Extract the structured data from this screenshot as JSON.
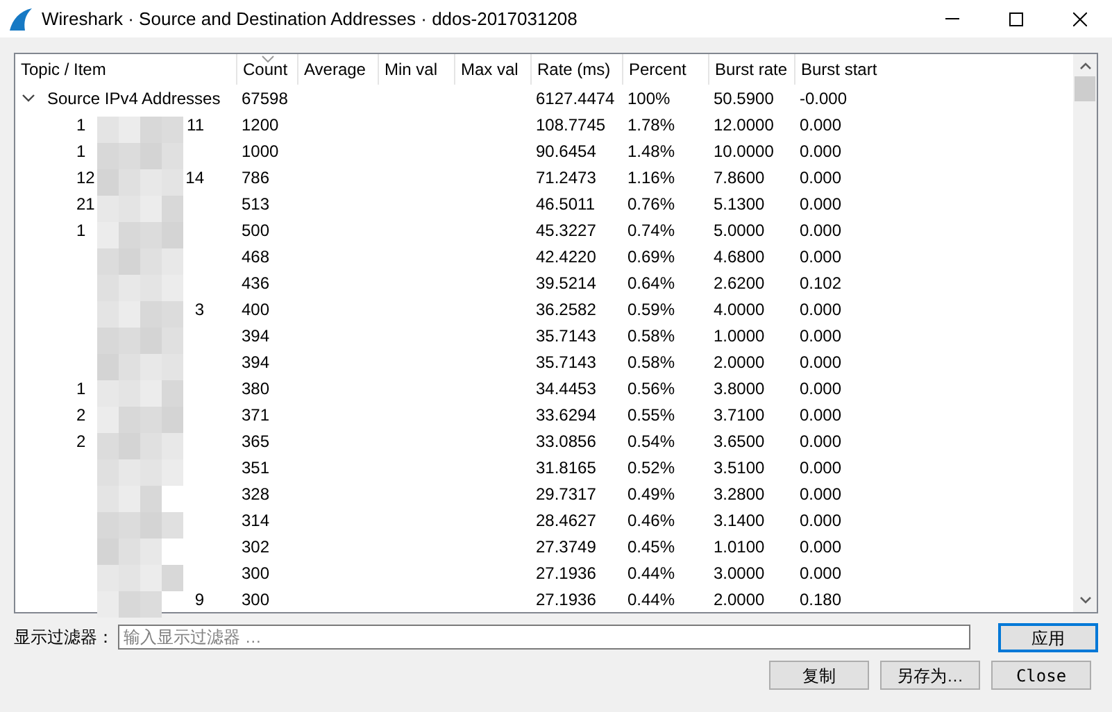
{
  "window": {
    "title": "Wireshark · Source and Destination Addresses · ddos-2017031208"
  },
  "table": {
    "columns": [
      {
        "label": "Topic / Item",
        "sorted": false
      },
      {
        "label": "Count",
        "sorted": true
      },
      {
        "label": "Average",
        "sorted": false
      },
      {
        "label": "Min val",
        "sorted": false
      },
      {
        "label": "Max val",
        "sorted": false
      },
      {
        "label": "Rate (ms)",
        "sorted": false
      },
      {
        "label": "Percent",
        "sorted": false
      },
      {
        "label": "Burst rate",
        "sorted": false
      },
      {
        "label": "Burst start",
        "sorted": false
      }
    ],
    "tree": [
      {
        "item": "Source IPv4 Addresses",
        "expanded": true,
        "count": "67598",
        "rate": "6127.4474",
        "percent": "100%",
        "burst_rate": "50.5900",
        "burst_start": "-0.000",
        "children": [
          {
            "item_head": "1",
            "item_tail": "11",
            "count": "1200",
            "rate": "108.7745",
            "percent": "1.78%",
            "burst_rate": "12.0000",
            "burst_start": "0.000"
          },
          {
            "item_head": "1",
            "count": "1000",
            "rate": "90.6454",
            "percent": "1.48%",
            "burst_rate": "10.0000",
            "burst_start": "0.000"
          },
          {
            "item_head": "12",
            "item_tail": "14",
            "count": "786",
            "rate": "71.2473",
            "percent": "1.16%",
            "burst_rate": "7.8600",
            "burst_start": "0.000"
          },
          {
            "item_head": "21",
            "count": "513",
            "rate": "46.5011",
            "percent": "0.76%",
            "burst_rate": "5.1300",
            "burst_start": "0.000"
          },
          {
            "item_head": "1",
            "count": "500",
            "rate": "45.3227",
            "percent": "0.74%",
            "burst_rate": "5.0000",
            "burst_start": "0.000"
          },
          {
            "count": "468",
            "rate": "42.4220",
            "percent": "0.69%",
            "burst_rate": "4.6800",
            "burst_start": "0.000"
          },
          {
            "count": "436",
            "rate": "39.5214",
            "percent": "0.64%",
            "burst_rate": "2.6200",
            "burst_start": "0.102"
          },
          {
            "item_tail": "3",
            "count": "400",
            "rate": "36.2582",
            "percent": "0.59%",
            "burst_rate": "4.0000",
            "burst_start": "0.000"
          },
          {
            "count": "394",
            "rate": "35.7143",
            "percent": "0.58%",
            "burst_rate": "1.0000",
            "burst_start": "0.000"
          },
          {
            "count": "394",
            "rate": "35.7143",
            "percent": "0.58%",
            "burst_rate": "2.0000",
            "burst_start": "0.000"
          },
          {
            "item_head": "1",
            "count": "380",
            "rate": "34.4453",
            "percent": "0.56%",
            "burst_rate": "3.8000",
            "burst_start": "0.000"
          },
          {
            "item_head": "2",
            "count": "371",
            "rate": "33.6294",
            "percent": "0.55%",
            "burst_rate": "3.7100",
            "burst_start": "0.000"
          },
          {
            "item_head": "2",
            "count": "365",
            "rate": "33.0856",
            "percent": "0.54%",
            "burst_rate": "3.6500",
            "burst_start": "0.000"
          },
          {
            "count": "351",
            "rate": "31.8165",
            "percent": "0.52%",
            "burst_rate": "3.5100",
            "burst_start": "0.000"
          },
          {
            "count": "328",
            "rate": "29.7317",
            "percent": "0.49%",
            "burst_rate": "3.2800",
            "burst_start": "0.000"
          },
          {
            "count": "314",
            "rate": "28.4627",
            "percent": "0.46%",
            "burst_rate": "3.1400",
            "burst_start": "0.000"
          },
          {
            "count": "302",
            "rate": "27.3749",
            "percent": "0.45%",
            "burst_rate": "1.0100",
            "burst_start": "0.000"
          },
          {
            "count": "300",
            "rate": "27.1936",
            "percent": "0.44%",
            "burst_rate": "3.0000",
            "burst_start": "0.000"
          },
          {
            "item_tail": "9",
            "count": "300",
            "rate": "27.1936",
            "percent": "0.44%",
            "burst_rate": "2.0000",
            "burst_start": "0.180"
          }
        ]
      }
    ]
  },
  "filter": {
    "label": "显示过滤器：",
    "placeholder": "输入显示过滤器 …",
    "apply": "应用"
  },
  "buttons": [
    {
      "label": "复制",
      "kind": "cjk"
    },
    {
      "label": "另存为…",
      "kind": "cjk"
    },
    {
      "label": "Close",
      "kind": "latin"
    }
  ]
}
